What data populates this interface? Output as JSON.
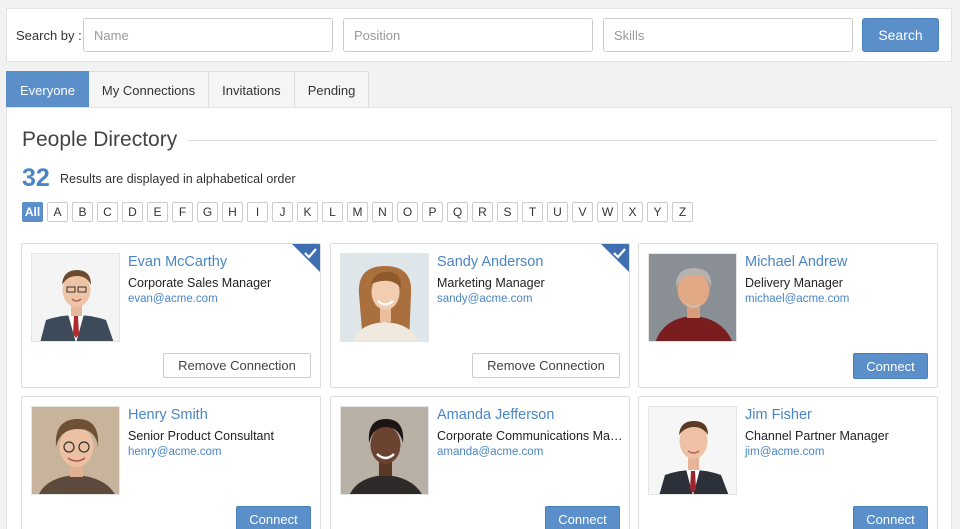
{
  "search": {
    "label": "Search by :",
    "name_placeholder": "Name",
    "position_placeholder": "Position",
    "skills_placeholder": "Skills",
    "button": "Search"
  },
  "tabs": [
    {
      "label": "Everyone",
      "active": true
    },
    {
      "label": "My Connections",
      "active": false
    },
    {
      "label": "Invitations",
      "active": false
    },
    {
      "label": "Pending",
      "active": false
    }
  ],
  "directory": {
    "title": "People Directory",
    "count": "32",
    "count_text": "Results are displayed in alphabetical order",
    "letters": [
      "All",
      "A",
      "B",
      "C",
      "D",
      "E",
      "F",
      "G",
      "H",
      "I",
      "J",
      "K",
      "L",
      "M",
      "N",
      "O",
      "P",
      "Q",
      "R",
      "S",
      "T",
      "U",
      "V",
      "W",
      "X",
      "Y",
      "Z"
    ],
    "active_letter": "All"
  },
  "people": [
    {
      "name": "Evan McCarthy",
      "role": "Corporate Sales Manager",
      "email": "evan@acme.com",
      "action": "Remove Connection",
      "connected": true
    },
    {
      "name": "Sandy Anderson",
      "role": "Marketing Manager",
      "email": "sandy@acme.com",
      "action": "Remove Connection",
      "connected": true
    },
    {
      "name": "Michael Andrew",
      "role": "Delivery Manager",
      "email": "michael@acme.com",
      "action": "Connect",
      "connected": false
    },
    {
      "name": "Henry Smith",
      "role": "Senior Product Consultant",
      "email": "henry@acme.com",
      "action": "Connect",
      "connected": false
    },
    {
      "name": "Amanda Jefferson",
      "role": "Corporate Communications Manager",
      "email": "amanda@acme.com",
      "action": "Connect",
      "connected": false
    },
    {
      "name": "Jim Fisher",
      "role": "Channel Partner Manager",
      "email": "jim@acme.com",
      "action": "Connect",
      "connected": false
    }
  ],
  "colors": {
    "accent": "#5b8fc9",
    "link": "#4a86c5",
    "check_corner": "#3f6fb0"
  }
}
